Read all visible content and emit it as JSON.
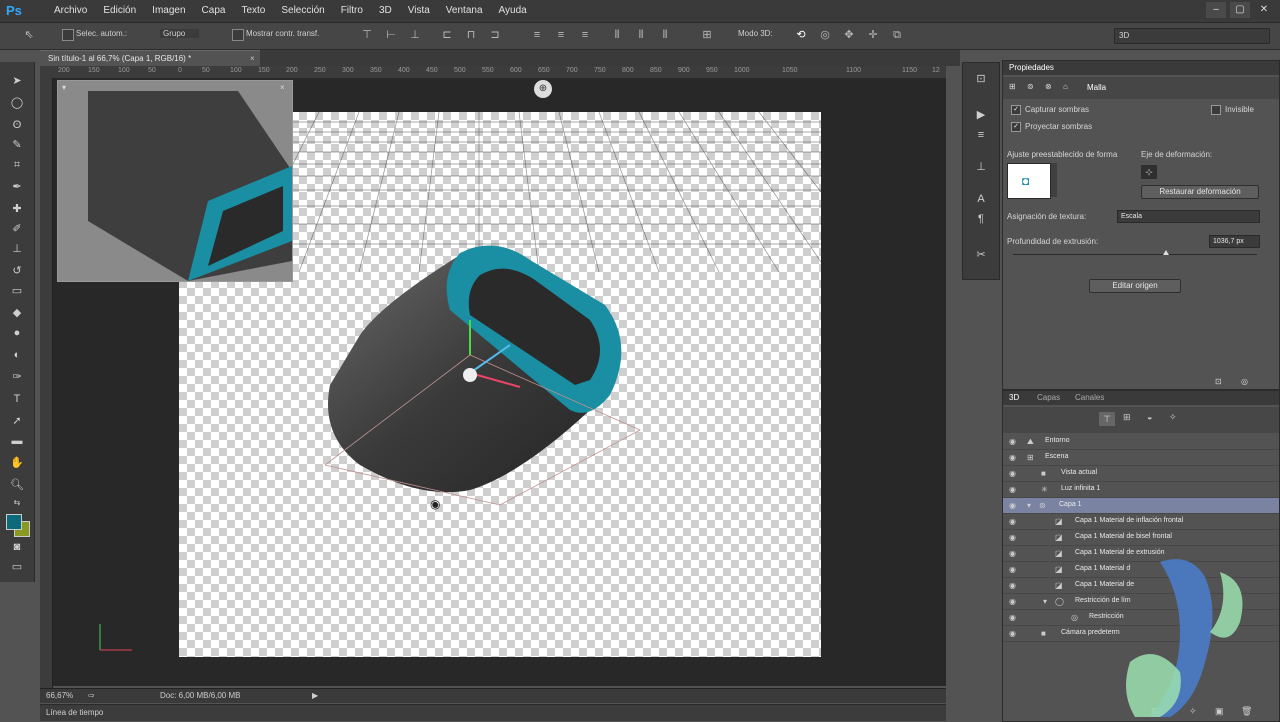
{
  "app": {
    "logo": "Ps"
  },
  "menu": [
    "Archivo",
    "Edición",
    "Imagen",
    "Capa",
    "Texto",
    "Selección",
    "Filtro",
    "3D",
    "Vista",
    "Ventana",
    "Ayuda"
  ],
  "window_controls": [
    "–",
    "▢",
    "✕"
  ],
  "options": {
    "auto_select_label": "Selec. autom.:",
    "auto_select_value": "Grupo",
    "transform_controls_label": "Mostrar contr. transf.",
    "mode_3d_label": "Modo 3D:",
    "workspace": "3D"
  },
  "document": {
    "tab_title": "Sin título-1 al 66,7% (Capa 1, RGB/16) *",
    "ruler_ticks": [
      "200",
      "150",
      "100",
      "50",
      "0",
      "50",
      "100",
      "150",
      "200",
      "250",
      "300",
      "350",
      "400",
      "450",
      "500",
      "550",
      "600",
      "650",
      "700",
      "750",
      "800",
      "850",
      "900",
      "950",
      "1000",
      "1050",
      "1100",
      "1150",
      "12"
    ]
  },
  "status": {
    "zoom": "66,67%",
    "doc": "Doc: 6,00 MB/6,00 MB"
  },
  "timeline_label": "Línea de tiempo",
  "properties": {
    "title": "Propiedades",
    "mesh_label": "Malla",
    "capture_shadows": "Capturar sombras",
    "invisible": "Invisible",
    "cast_shadows": "Proyectar sombras",
    "preset_label": "Ajuste preestablecido de forma",
    "deform_axis_label": "Eje de deformación:",
    "reset_deformation": "Restaurar deformación",
    "texture_mapping_label": "Asignación de textura:",
    "texture_mapping_value": "Escala",
    "extrusion_depth_label": "Profundidad de extrusión:",
    "extrusion_depth_value": "1036,7 px",
    "edit_origin": "Editar origen"
  },
  "panel3d": {
    "tabs": [
      "3D",
      "Capas",
      "Canales"
    ],
    "layers": [
      {
        "name": "Entorno",
        "indent": 0,
        "icon": "environment-icon",
        "selected": false
      },
      {
        "name": "Escena",
        "indent": 0,
        "icon": "scene-icon",
        "selected": false
      },
      {
        "name": "Vista actual",
        "indent": 1,
        "icon": "camera-icon",
        "selected": false
      },
      {
        "name": "Luz infinita 1",
        "indent": 1,
        "icon": "light-icon",
        "selected": false
      },
      {
        "name": "Capa 1",
        "indent": 1,
        "icon": "mesh-icon",
        "selected": true
      },
      {
        "name": "Capa 1 Material de inflación frontal",
        "indent": 2,
        "icon": "material-icon",
        "selected": false
      },
      {
        "name": "Capa 1 Material de bisel frontal",
        "indent": 2,
        "icon": "material-icon",
        "selected": false
      },
      {
        "name": "Capa 1 Material de extrusión",
        "indent": 2,
        "icon": "material-icon",
        "selected": false
      },
      {
        "name": "Capa 1 Material d",
        "indent": 2,
        "icon": "material-icon",
        "selected": false
      },
      {
        "name": "Capa 1 Material de",
        "indent": 2,
        "icon": "material-icon",
        "selected": false
      },
      {
        "name": "Restricción de lím",
        "indent": 2,
        "icon": "constraint-icon",
        "selected": false
      },
      {
        "name": "Restricción",
        "indent": 3,
        "icon": "constraint-icon",
        "selected": false
      },
      {
        "name": "Cámara predeterm",
        "indent": 1,
        "icon": "camera-icon",
        "selected": false
      }
    ]
  },
  "colors": {
    "accent_teal": "#1a8fa3",
    "foreground_swatch": "#0b6b7a",
    "background_swatch": "#8a9a20",
    "selected_row": "#7b83a3"
  }
}
